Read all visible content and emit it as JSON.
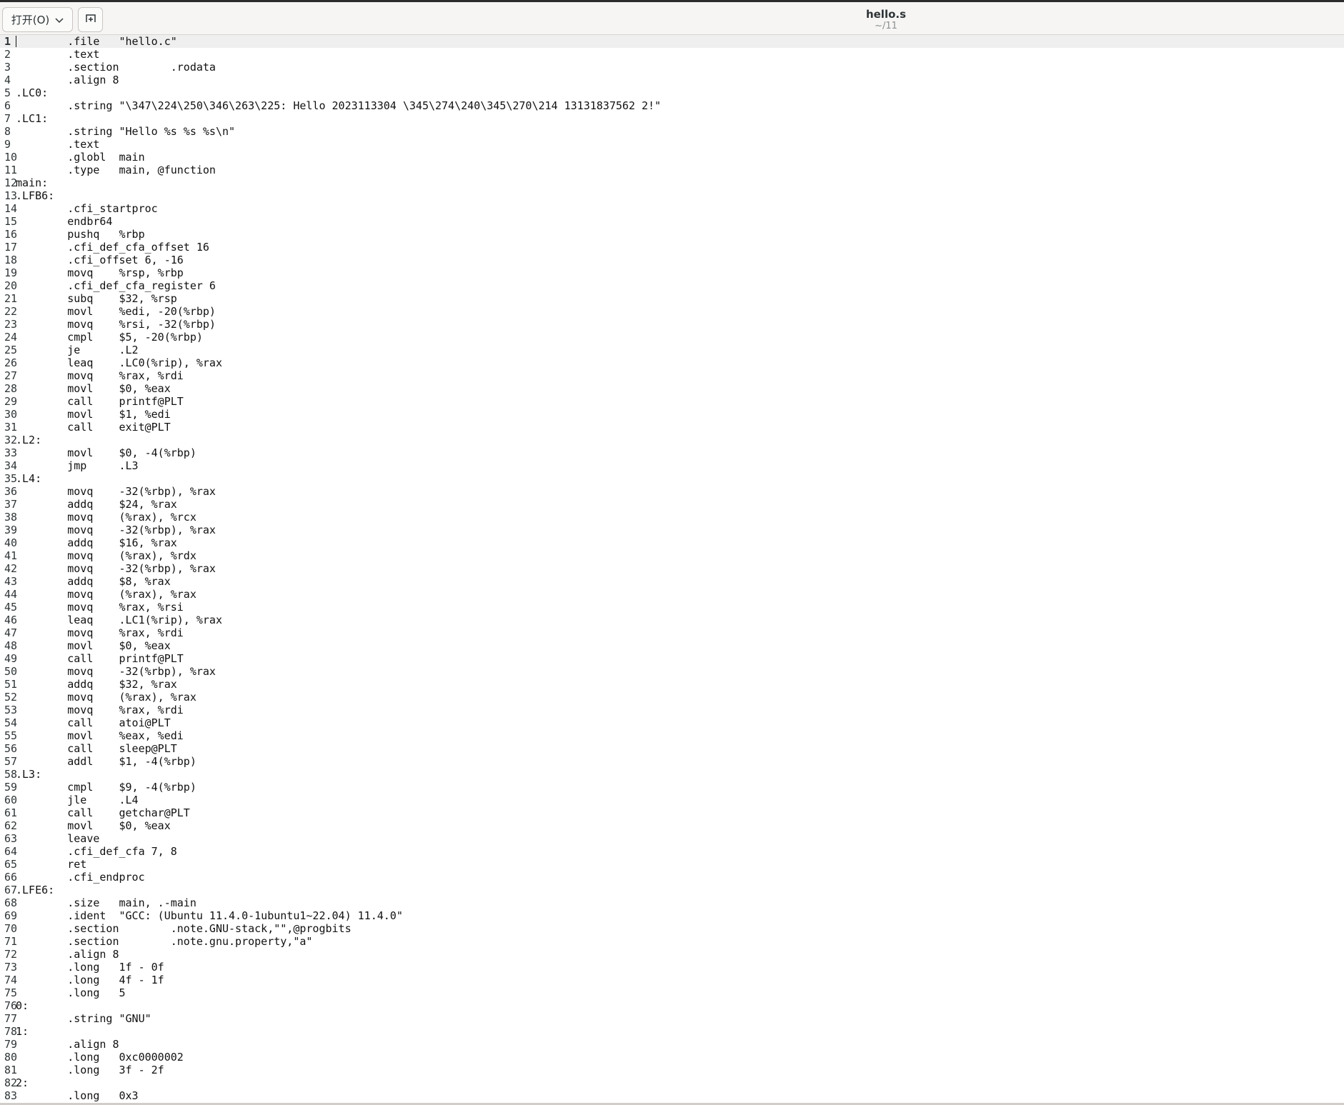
{
  "header": {
    "open_button_label": "打开(O)",
    "open_dropdown_icon": "chevron-down-icon",
    "pin_icon": "new-tab-icon",
    "title": "hello.s",
    "subtitle": "~/11"
  },
  "editor": {
    "current_line": 1,
    "lines": [
      {
        "n": "1",
        "t": "        .file   \"hello.c\""
      },
      {
        "n": "2",
        "t": "        .text"
      },
      {
        "n": "3",
        "t": "        .section        .rodata"
      },
      {
        "n": "4",
        "t": "        .align 8"
      },
      {
        "n": "5",
        "t": ".LC0:"
      },
      {
        "n": "6",
        "t": "        .string \"\\347\\224\\250\\346\\263\\225: Hello 2023113304 \\345\\274\\240\\345\\270\\214 13131837562 2!\""
      },
      {
        "n": "7",
        "t": ".LC1:"
      },
      {
        "n": "8",
        "t": "        .string \"Hello %s %s %s\\n\""
      },
      {
        "n": "9",
        "t": "        .text"
      },
      {
        "n": "10",
        "t": "        .globl  main"
      },
      {
        "n": "11",
        "t": "        .type   main, @function"
      },
      {
        "n": "12",
        "t": "main:"
      },
      {
        "n": "13",
        "t": ".LFB6:"
      },
      {
        "n": "14",
        "t": "        .cfi_startproc"
      },
      {
        "n": "15",
        "t": "        endbr64"
      },
      {
        "n": "16",
        "t": "        pushq   %rbp"
      },
      {
        "n": "17",
        "t": "        .cfi_def_cfa_offset 16"
      },
      {
        "n": "18",
        "t": "        .cfi_offset 6, -16"
      },
      {
        "n": "19",
        "t": "        movq    %rsp, %rbp"
      },
      {
        "n": "20",
        "t": "        .cfi_def_cfa_register 6"
      },
      {
        "n": "21",
        "t": "        subq    $32, %rsp"
      },
      {
        "n": "22",
        "t": "        movl    %edi, -20(%rbp)"
      },
      {
        "n": "23",
        "t": "        movq    %rsi, -32(%rbp)"
      },
      {
        "n": "24",
        "t": "        cmpl    $5, -20(%rbp)"
      },
      {
        "n": "25",
        "t": "        je      .L2"
      },
      {
        "n": "26",
        "t": "        leaq    .LC0(%rip), %rax"
      },
      {
        "n": "27",
        "t": "        movq    %rax, %rdi"
      },
      {
        "n": "28",
        "t": "        movl    $0, %eax"
      },
      {
        "n": "29",
        "t": "        call    printf@PLT"
      },
      {
        "n": "30",
        "t": "        movl    $1, %edi"
      },
      {
        "n": "31",
        "t": "        call    exit@PLT"
      },
      {
        "n": "32",
        "t": ".L2:"
      },
      {
        "n": "33",
        "t": "        movl    $0, -4(%rbp)"
      },
      {
        "n": "34",
        "t": "        jmp     .L3"
      },
      {
        "n": "35",
        "t": ".L4:"
      },
      {
        "n": "36",
        "t": "        movq    -32(%rbp), %rax"
      },
      {
        "n": "37",
        "t": "        addq    $24, %rax"
      },
      {
        "n": "38",
        "t": "        movq    (%rax), %rcx"
      },
      {
        "n": "39",
        "t": "        movq    -32(%rbp), %rax"
      },
      {
        "n": "40",
        "t": "        addq    $16, %rax"
      },
      {
        "n": "41",
        "t": "        movq    (%rax), %rdx"
      },
      {
        "n": "42",
        "t": "        movq    -32(%rbp), %rax"
      },
      {
        "n": "43",
        "t": "        addq    $8, %rax"
      },
      {
        "n": "44",
        "t": "        movq    (%rax), %rax"
      },
      {
        "n": "45",
        "t": "        movq    %rax, %rsi"
      },
      {
        "n": "46",
        "t": "        leaq    .LC1(%rip), %rax"
      },
      {
        "n": "47",
        "t": "        movq    %rax, %rdi"
      },
      {
        "n": "48",
        "t": "        movl    $0, %eax"
      },
      {
        "n": "49",
        "t": "        call    printf@PLT"
      },
      {
        "n": "50",
        "t": "        movq    -32(%rbp), %rax"
      },
      {
        "n": "51",
        "t": "        addq    $32, %rax"
      },
      {
        "n": "52",
        "t": "        movq    (%rax), %rax"
      },
      {
        "n": "53",
        "t": "        movq    %rax, %rdi"
      },
      {
        "n": "54",
        "t": "        call    atoi@PLT"
      },
      {
        "n": "55",
        "t": "        movl    %eax, %edi"
      },
      {
        "n": "56",
        "t": "        call    sleep@PLT"
      },
      {
        "n": "57",
        "t": "        addl    $1, -4(%rbp)"
      },
      {
        "n": "58",
        "t": ".L3:"
      },
      {
        "n": "59",
        "t": "        cmpl    $9, -4(%rbp)"
      },
      {
        "n": "60",
        "t": "        jle     .L4"
      },
      {
        "n": "61",
        "t": "        call    getchar@PLT"
      },
      {
        "n": "62",
        "t": "        movl    $0, %eax"
      },
      {
        "n": "63",
        "t": "        leave"
      },
      {
        "n": "64",
        "t": "        .cfi_def_cfa 7, 8"
      },
      {
        "n": "65",
        "t": "        ret"
      },
      {
        "n": "66",
        "t": "        .cfi_endproc"
      },
      {
        "n": "67",
        "t": ".LFE6:"
      },
      {
        "n": "68",
        "t": "        .size   main, .-main"
      },
      {
        "n": "69",
        "t": "        .ident  \"GCC: (Ubuntu 11.4.0-1ubuntu1~22.04) 11.4.0\""
      },
      {
        "n": "70",
        "t": "        .section        .note.GNU-stack,\"\",@progbits"
      },
      {
        "n": "71",
        "t": "        .section        .note.gnu.property,\"a\""
      },
      {
        "n": "72",
        "t": "        .align 8"
      },
      {
        "n": "73",
        "t": "        .long   1f - 0f"
      },
      {
        "n": "74",
        "t": "        .long   4f - 1f"
      },
      {
        "n": "75",
        "t": "        .long   5"
      },
      {
        "n": "76",
        "t": "0:"
      },
      {
        "n": "77",
        "t": "        .string \"GNU\""
      },
      {
        "n": "78",
        "t": "1:"
      },
      {
        "n": "79",
        "t": "        .align 8"
      },
      {
        "n": "80",
        "t": "        .long   0xc0000002"
      },
      {
        "n": "81",
        "t": "        .long   3f - 2f"
      },
      {
        "n": "82",
        "t": "2:"
      },
      {
        "n": "83",
        "t": "        .long   0x3"
      }
    ]
  }
}
